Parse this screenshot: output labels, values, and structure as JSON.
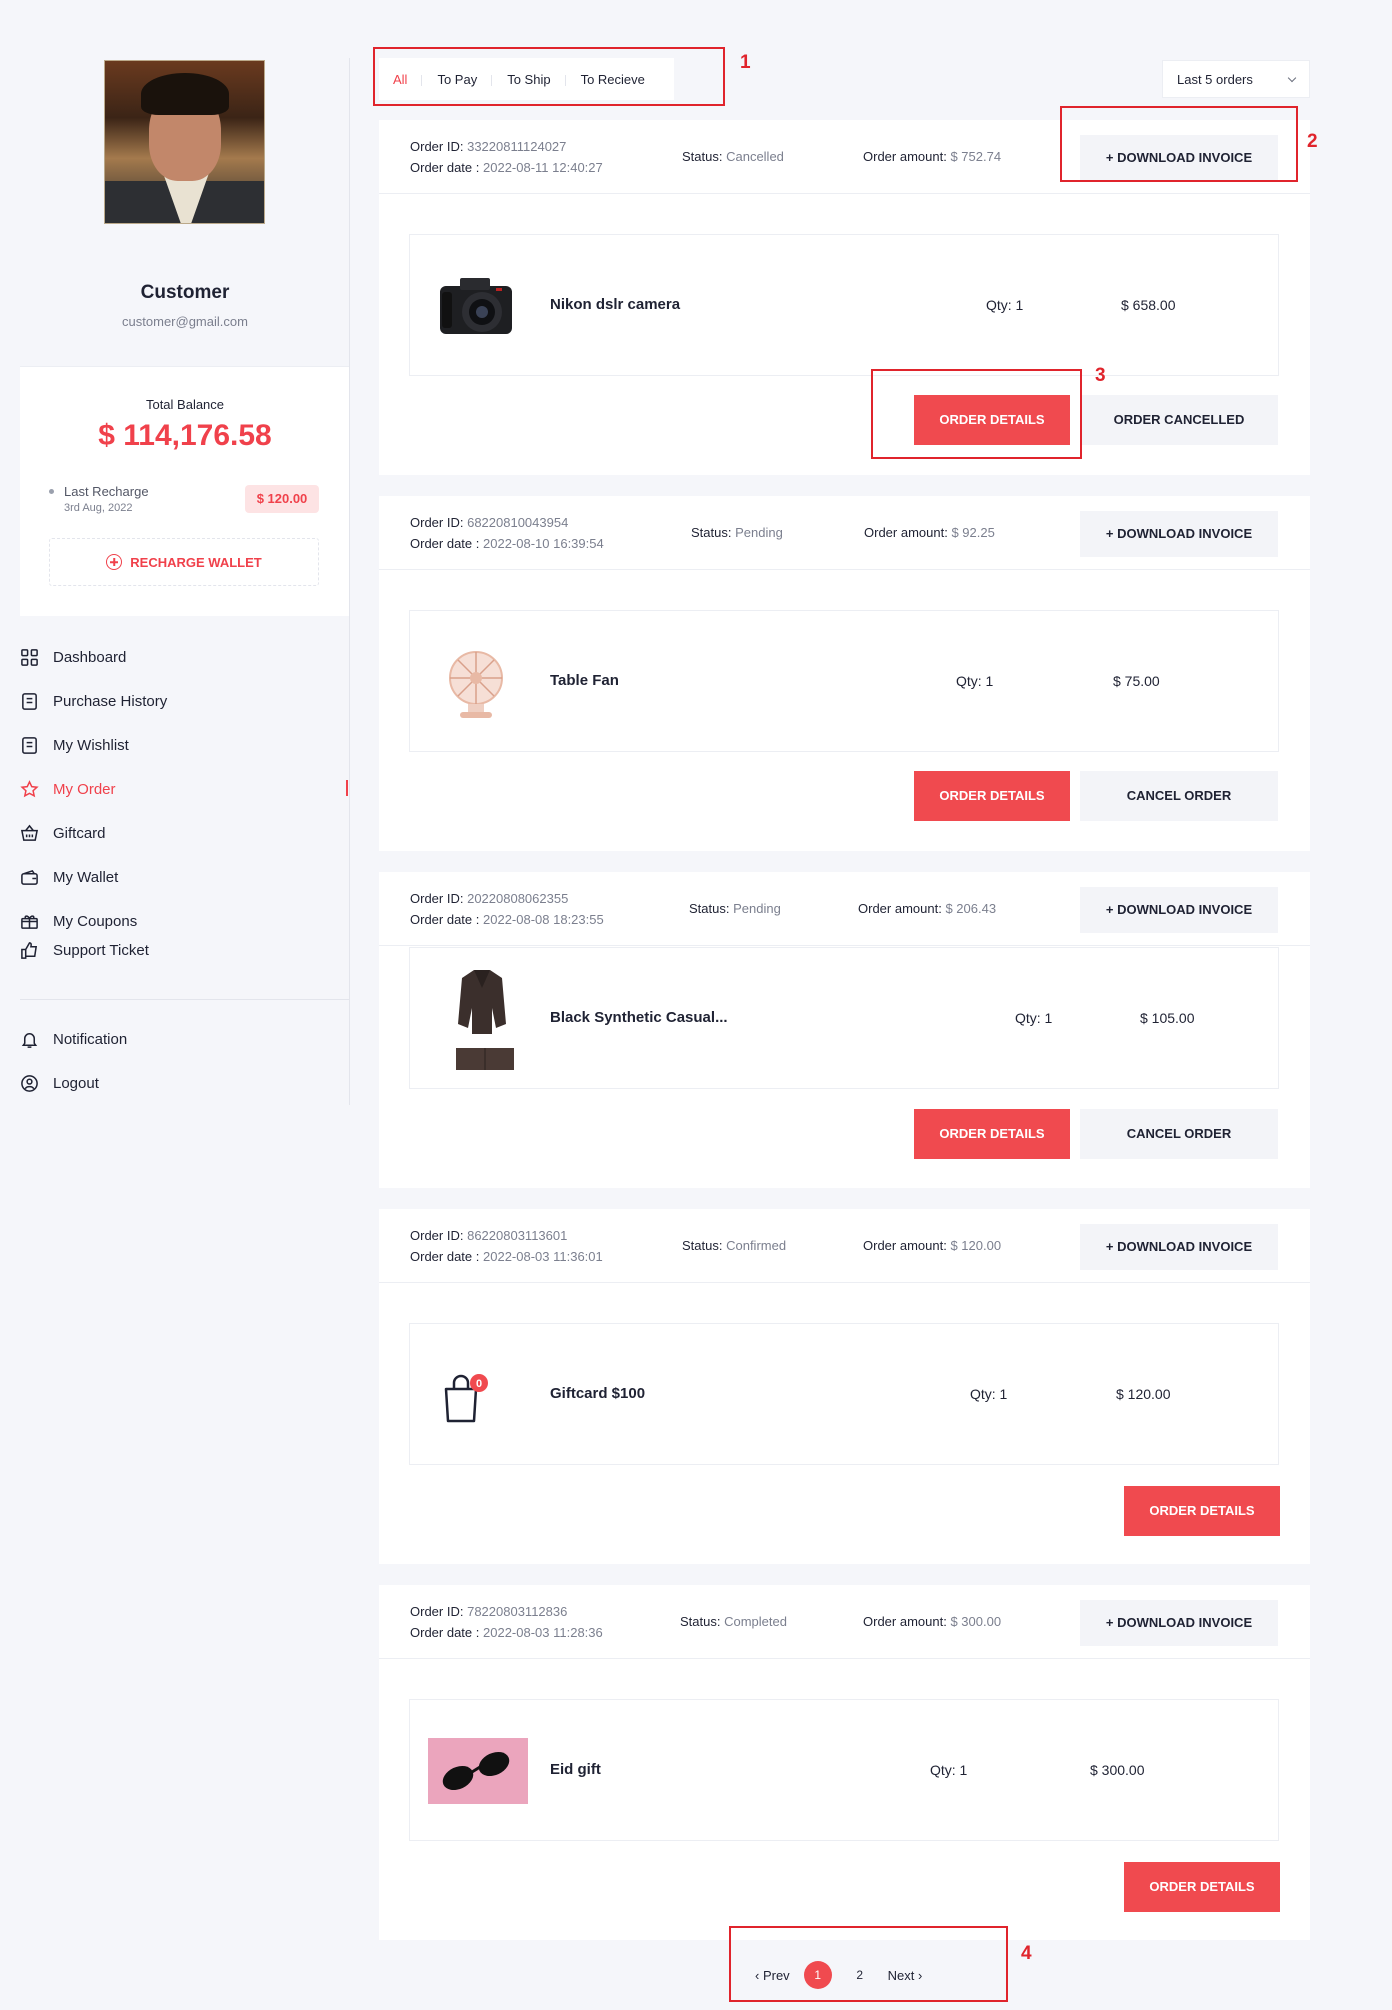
{
  "profile": {
    "name": "Customer",
    "email": "customer@gmail.com"
  },
  "balance": {
    "label": "Total Balance",
    "value": "$ 114,176.58",
    "last_recharge_label": "Last Recharge",
    "last_recharge_date": "3rd Aug, 2022",
    "last_recharge_amount": "$ 120.00",
    "recharge_button": "RECHARGE WALLET"
  },
  "nav": {
    "items": [
      {
        "label": "Dashboard",
        "icon": "dashboard-icon"
      },
      {
        "label": "Purchase History",
        "icon": "purchase-history-icon"
      },
      {
        "label": "My Wishlist",
        "icon": "wishlist-icon"
      },
      {
        "label": "My Order",
        "icon": "star-icon",
        "active": true
      },
      {
        "label": "Giftcard",
        "icon": "basket-icon"
      },
      {
        "label": "My Wallet",
        "icon": "wallet-icon"
      },
      {
        "label": "My Coupons",
        "icon": "coupon-icon"
      },
      {
        "label": "Support Ticket",
        "icon": "thumbs-up-icon"
      }
    ],
    "bottom_items": [
      {
        "label": "Notification",
        "icon": "bell-icon"
      },
      {
        "label": "Logout",
        "icon": "logout-icon"
      }
    ]
  },
  "tabs": [
    "All",
    "To Pay",
    "To Ship",
    "To Recieve"
  ],
  "active_tab": "All",
  "order_filter": "Last 5 orders",
  "labels": {
    "order_id": "Order ID:",
    "order_date": "Order date :",
    "status": "Status:",
    "order_amount": "Order amount:",
    "download_invoice": "+ DOWNLOAD INVOICE",
    "order_details": "ORDER DETAILS",
    "cancel_order": "CANCEL ORDER",
    "order_cancelled": "ORDER CANCELLED",
    "qty_prefix": "Qty: "
  },
  "orders": [
    {
      "id": "33220811124027",
      "date": "2022-08-11 12:40:27",
      "status": "Cancelled",
      "amount": "$ 752.74",
      "product": "Nikon dslr camera",
      "qty": "Qty: 1",
      "price": "$ 658.00",
      "image": "camera-image",
      "secondary_action": "ORDER CANCELLED"
    },
    {
      "id": "68220810043954",
      "date": "2022-08-10 16:39:54",
      "status": "Pending",
      "amount": "$ 92.25",
      "product": "Table Fan",
      "qty": "Qty: 1",
      "price": "$ 75.00",
      "image": "table-fan-image",
      "secondary_action": "CANCEL ORDER"
    },
    {
      "id": "20220808062355",
      "date": "2022-08-08 18:23:55",
      "status": "Pending",
      "amount": "$ 206.43",
      "product": "Black Synthetic Casual...",
      "qty": "Qty: 1",
      "price": "$ 105.00",
      "image": "suit-image",
      "secondary_action": "CANCEL ORDER"
    },
    {
      "id": "86220803113601",
      "date": "2022-08-03 11:36:01",
      "status": "Confirmed",
      "amount": "$ 120.00",
      "product": "Giftcard $100",
      "qty": "Qty: 1",
      "price": "$ 120.00",
      "image": "shopping-bag-icon",
      "badge": "0"
    },
    {
      "id": "78220803112836",
      "date": "2022-08-03 11:28:36",
      "status": "Completed",
      "amount": "$ 300.00",
      "product": "Eid gift",
      "qty": "Qty: 1",
      "price": "$ 300.00",
      "image": "sunglasses-image"
    }
  ],
  "pagination": {
    "prev": "‹ Prev",
    "pages": [
      "1",
      "2"
    ],
    "current": "1",
    "next": "Next ›"
  },
  "annotations": [
    "1",
    "2",
    "3",
    "4"
  ],
  "colors": {
    "accent": "#f04a4f",
    "annotation": "#e0242c",
    "background": "#f5f6fa"
  }
}
